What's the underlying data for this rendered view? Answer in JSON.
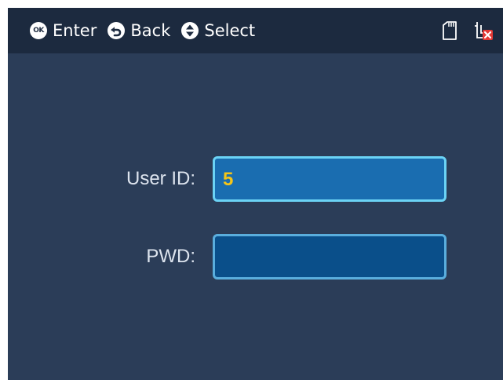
{
  "topbar": {
    "hints": {
      "ok_icon_text": "OK",
      "enter_label": "Enter",
      "back_label": "Back",
      "select_label": "Select"
    },
    "icons": {
      "ok": "ok-button-icon",
      "back": "back-arrow-icon",
      "select": "up-down-select-icon",
      "sd_card": "sd-card-icon",
      "network_error": "network-disconnected-icon"
    }
  },
  "form": {
    "user_id": {
      "label": "User ID:",
      "value": "5",
      "focused": true
    },
    "password": {
      "label": "PWD:",
      "value": "",
      "focused": false
    }
  },
  "colors": {
    "screen_background": "#2b3d58",
    "topbar_background": "#1c2a3f",
    "input_active_fill": "#1a6db0",
    "input_active_border": "#6bd3f5",
    "input_idle_fill": "#0a4f8a",
    "input_idle_border": "#5aaedd",
    "input_text": "#f5c518",
    "status_error": "#e53935"
  }
}
